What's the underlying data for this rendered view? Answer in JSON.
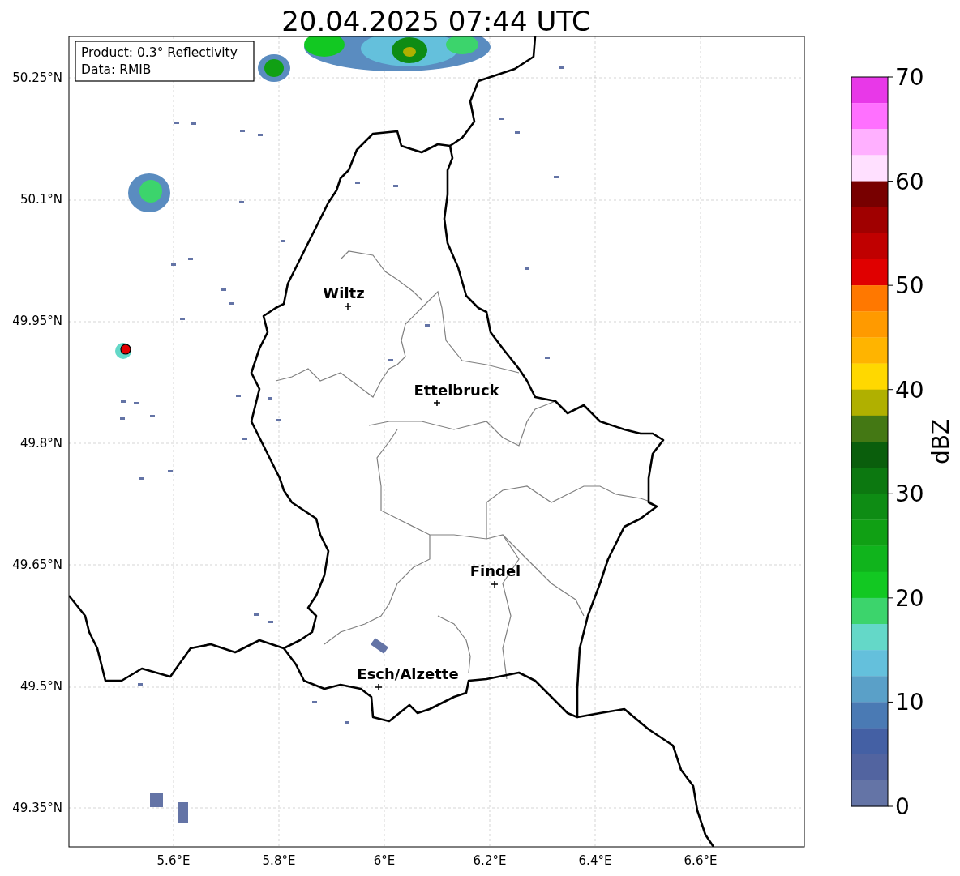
{
  "title": "20.04.2025 07:44 UTC",
  "info_box": [
    "Product: 0.3° Reflectivity",
    "Data: RMIB"
  ],
  "map": {
    "lat_labels": [
      "50.25°N",
      "50.1°N",
      "49.95°N",
      "49.8°N",
      "49.65°N",
      "49.5°N",
      "49.35°N"
    ],
    "lon_labels": [
      "5.6°E",
      "5.8°E",
      "6°E",
      "6.2°E",
      "6.4°E",
      "6.6°E"
    ],
    "cities": [
      {
        "name": "Wiltz"
      },
      {
        "name": "Ettelbruck"
      },
      {
        "name": "Findel"
      },
      {
        "name": "Esch/Alzette"
      }
    ]
  },
  "colorbar": {
    "label": "dBZ",
    "ticks": [
      "70",
      "60",
      "50",
      "40",
      "30",
      "20",
      "10",
      "0"
    ],
    "segments": [
      {
        "color": "#e838e8"
      },
      {
        "color": "#ff70ff"
      },
      {
        "color": "#ffb0ff"
      },
      {
        "color": "#ffe0ff"
      },
      {
        "color": "#780000"
      },
      {
        "color": "#a00000"
      },
      {
        "color": "#c00000"
      },
      {
        "color": "#e00000"
      },
      {
        "color": "#ff7800"
      },
      {
        "color": "#ff9a00"
      },
      {
        "color": "#ffb400"
      },
      {
        "color": "#ffd800"
      },
      {
        "color": "#b0b000"
      },
      {
        "color": "#447814"
      },
      {
        "color": "#0a5e0c"
      },
      {
        "color": "#0c7810"
      },
      {
        "color": "#0e8c14"
      },
      {
        "color": "#10a014"
      },
      {
        "color": "#10b41c"
      },
      {
        "color": "#12c822"
      },
      {
        "color": "#3cd46c"
      },
      {
        "color": "#64d8c8"
      },
      {
        "color": "#64c0dc"
      },
      {
        "color": "#5aa0c8"
      },
      {
        "color": "#4a7ab4"
      },
      {
        "color": "#4460a4"
      },
      {
        "color": "#5264a0"
      },
      {
        "color": "#6474a6"
      }
    ]
  }
}
